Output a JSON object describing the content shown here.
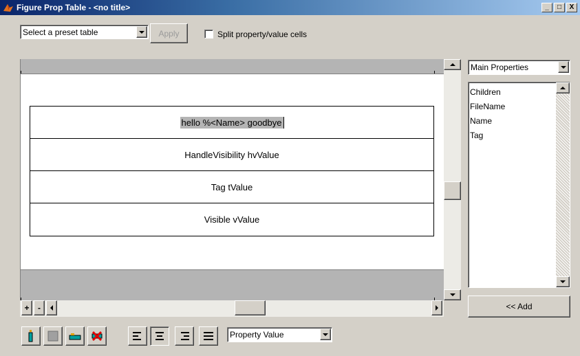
{
  "window": {
    "title": "Figure Prop Table - <no title>",
    "minimize": "_",
    "maximize": "□",
    "close": "X"
  },
  "toolbar": {
    "preset_select": "Select a preset table",
    "apply_label": "Apply",
    "split_label": "Split property/value cells",
    "split_checked": false
  },
  "table": {
    "rows": [
      "hello %<Name> goodbye",
      "HandleVisibility hvValue",
      "Tag tValue",
      "Visible vValue"
    ]
  },
  "scrollbar": {
    "add_row": "+",
    "remove_row": "-"
  },
  "right_panel": {
    "properties_select": "Main Properties",
    "items": [
      "Children",
      "FileName",
      "Name",
      "Tag"
    ],
    "add_label": "<< Add"
  },
  "bottom_toolbar": {
    "icons": [
      "insert-column-icon",
      "gray-cell-icon",
      "frame-icon",
      "delete-icon",
      "align-left-icon",
      "align-center-icon",
      "align-right-icon",
      "align-justify-icon"
    ],
    "format_select": "Property Value"
  },
  "colors": {
    "window_bg": "#d4d0c8",
    "band_gray": "#b4b4b4",
    "title_gradient_start": "#0a246a",
    "title_gradient_end": "#a6caf0"
  }
}
